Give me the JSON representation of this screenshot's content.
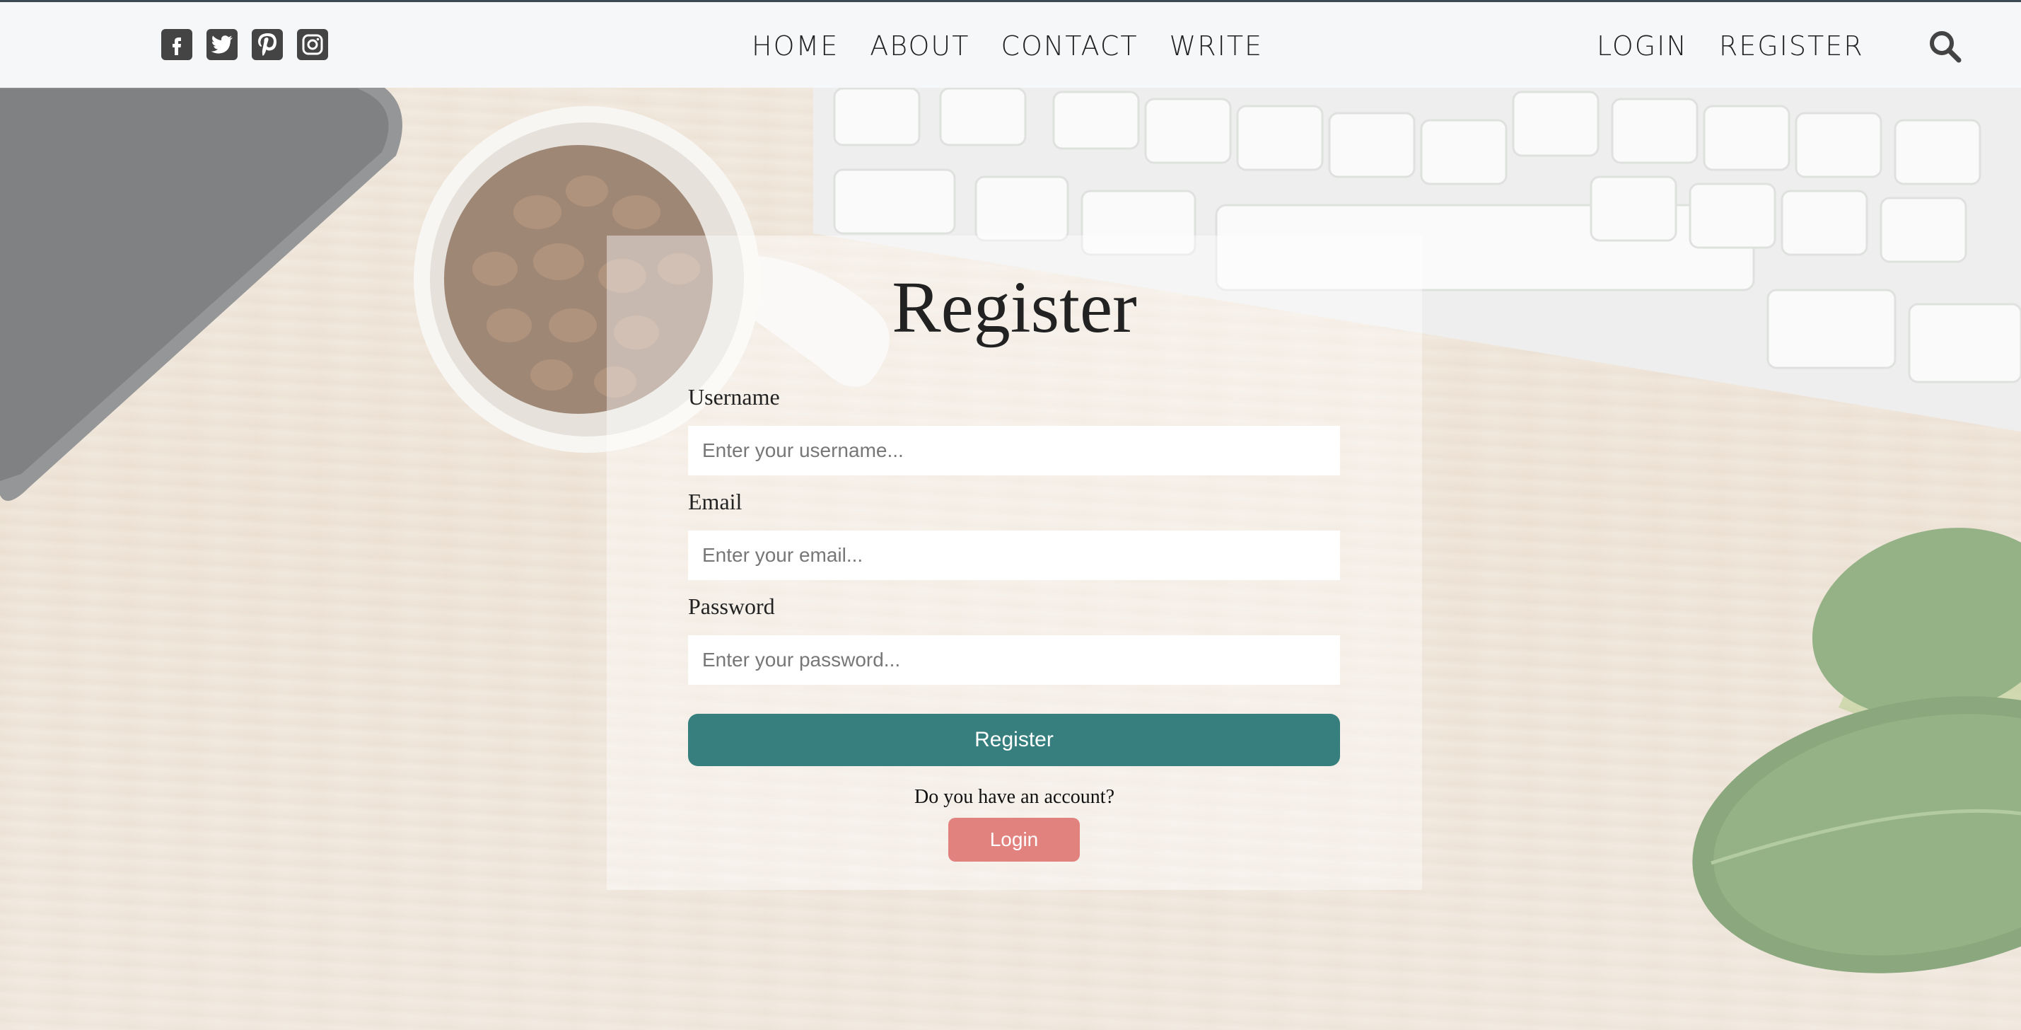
{
  "nav": {
    "social_icons": [
      "facebook-icon",
      "twitter-icon",
      "pinterest-icon",
      "instagram-icon"
    ],
    "center_links": [
      "HOME",
      "ABOUT",
      "CONTACT",
      "WRITE"
    ],
    "right_links": [
      "LOGIN",
      "REGISTER"
    ],
    "search_icon": "search-icon"
  },
  "register": {
    "title": "Register",
    "username": {
      "label": "Username",
      "placeholder": "Enter your username..."
    },
    "email": {
      "label": "Email",
      "placeholder": "Enter your email..."
    },
    "password": {
      "label": "Password",
      "placeholder": "Enter your password..."
    },
    "submit_label": "Register",
    "account_prompt": "Do you have an account?",
    "login_label": "Login"
  },
  "colors": {
    "primary": "#367f7e",
    "secondary": "#e2827e",
    "topbar": "#f6f7f9"
  }
}
